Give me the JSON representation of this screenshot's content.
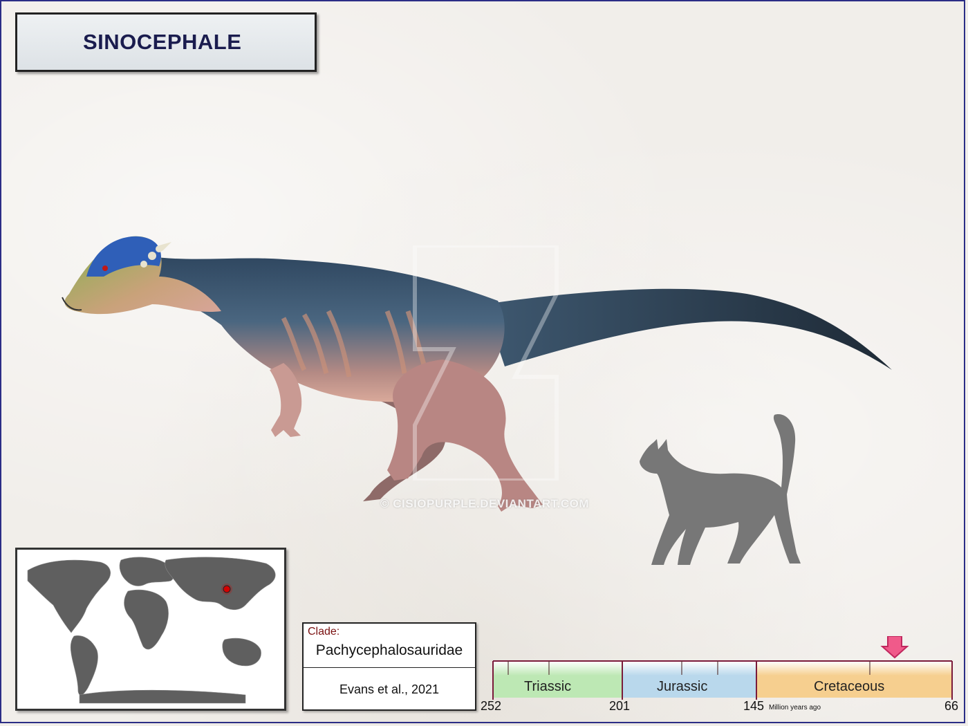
{
  "title": "SINOCEPHALE",
  "watermark": "© CISIOPURPLE.DEVIANTART.COM",
  "clade": {
    "label": "Clade:",
    "name": "Pachycephalosauridae",
    "authority": "Evans et al., 2021"
  },
  "timeline": {
    "periods": [
      {
        "name": "Triassic",
        "color": "#bde8b4"
      },
      {
        "name": "Jurassic",
        "color": "#b9d8ec"
      },
      {
        "name": "Cretaceous",
        "color": "#f6cf8f"
      }
    ],
    "ticks": [
      "252",
      "201",
      "145",
      "66"
    ],
    "unit": "Million years ago",
    "marker_color": "#f05a8a",
    "axis_color": "#7a1a3a"
  },
  "map": {
    "land_color": "#5f5f5f",
    "locality_color": "#d40000"
  },
  "scale_silhouette": "cat-silhouette-icon"
}
